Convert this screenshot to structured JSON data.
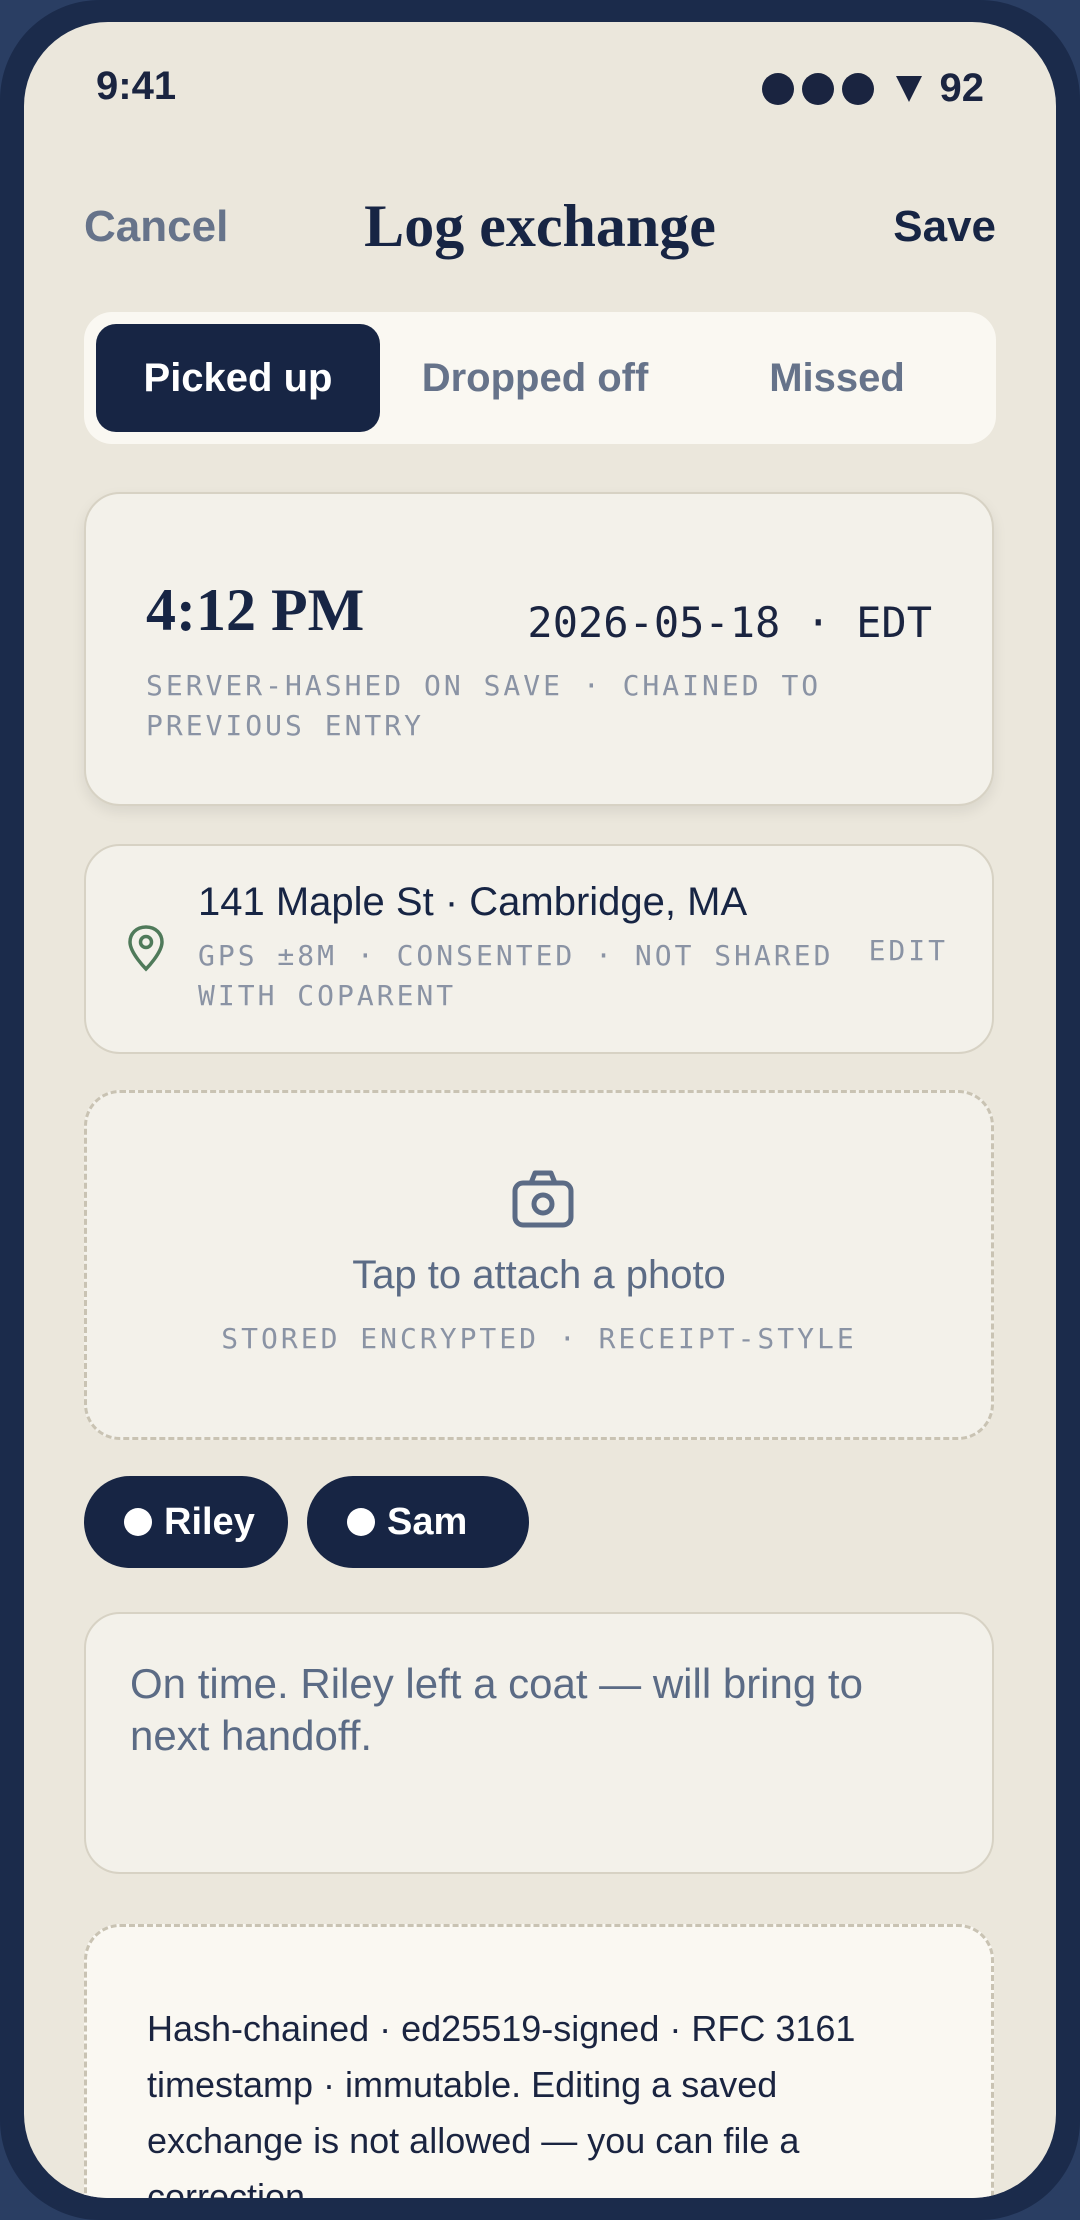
{
  "status_bar": {
    "time": "9:41",
    "battery": "92"
  },
  "header": {
    "cancel": "Cancel",
    "title": "Log exchange",
    "save": "Save"
  },
  "segments": [
    {
      "label": "Picked up",
      "selected": true
    },
    {
      "label": "Dropped off",
      "selected": false
    },
    {
      "label": "Missed",
      "selected": false
    }
  ],
  "time_card": {
    "time": "4:12 PM",
    "date_tz": "2026-05-18 · EDT",
    "note": "SERVER-HASHED ON SAVE · CHAINED TO PREVIOUS ENTRY"
  },
  "location": {
    "address": "141 Maple St · Cambridge, MA",
    "note": "GPS ±8M · CONSENTED · NOT SHARED WITH COPARENT",
    "edit": "EDIT",
    "icon": "map-pin-icon"
  },
  "photo": {
    "icon": "camera-icon",
    "title": "Tap to attach a photo",
    "note": "STORED ENCRYPTED · RECEIPT-STYLE"
  },
  "children": [
    {
      "name": "Riley"
    },
    {
      "name": "Sam"
    }
  ],
  "notes": {
    "text": "On time. Riley left a coat — will bring to next handoff."
  },
  "integrity": {
    "text": "Hash-chained · ed25519-signed · RFC 3161 timestamp · immutable. Editing a saved exchange is not allowed — you can file a correction."
  },
  "colors": {
    "accent": "#172544",
    "background": "#ebe7dc",
    "muted": "#66738a",
    "pin": "#4f7a5a"
  }
}
